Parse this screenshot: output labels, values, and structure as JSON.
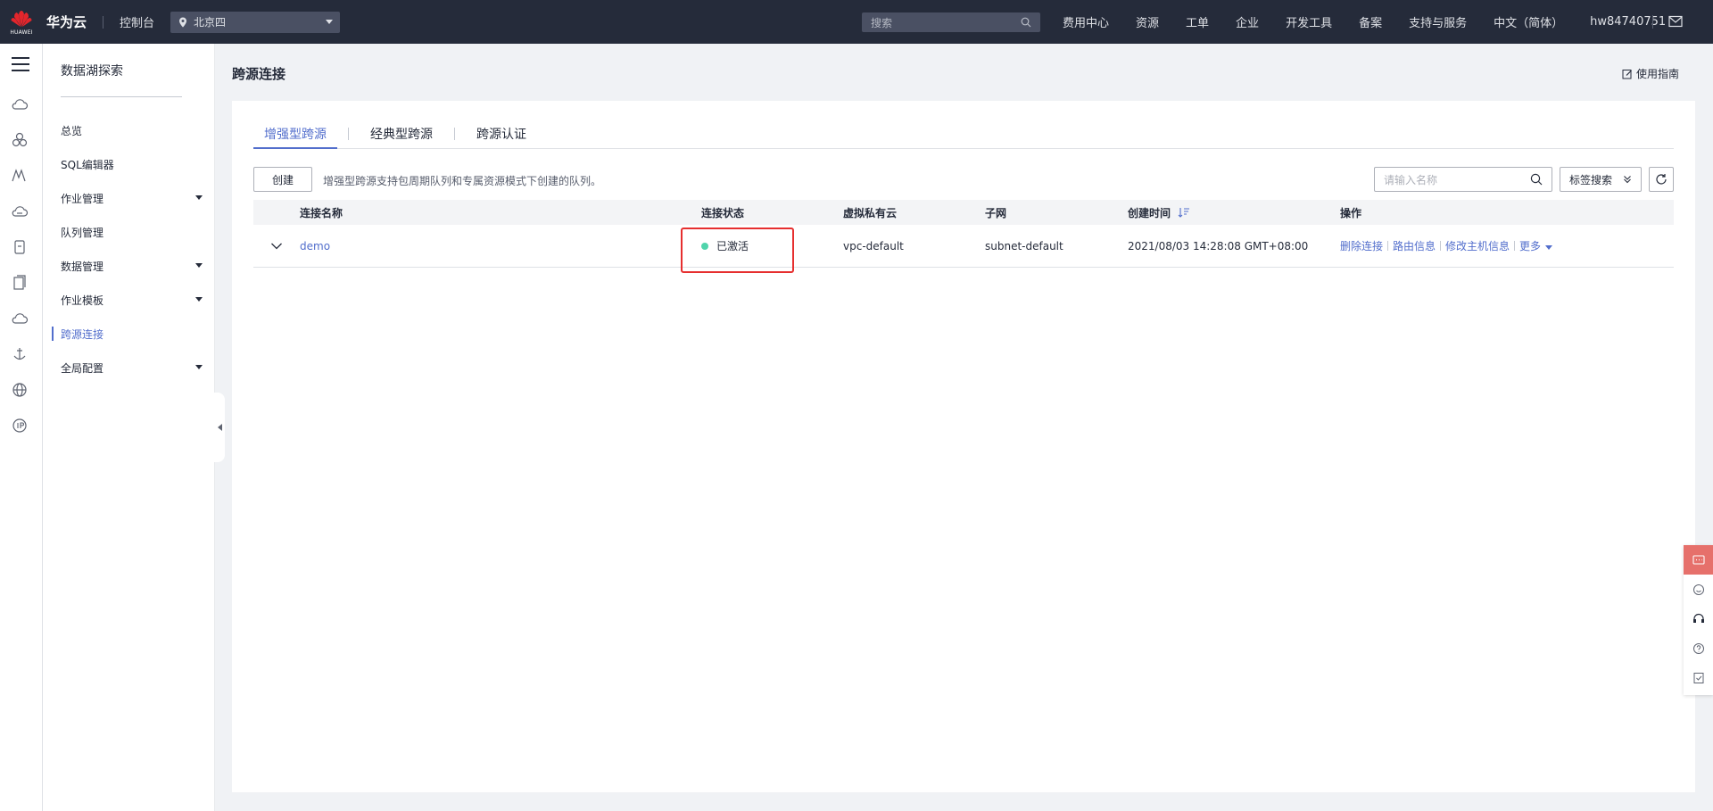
{
  "topbar": {
    "logo_text": "HUAWEI",
    "brand": "华为云",
    "console": "控制台",
    "region": "北京四",
    "search_placeholder": "搜索",
    "nav": [
      "费用中心",
      "资源",
      "工单",
      "企业",
      "开发工具",
      "备案",
      "支持与服务",
      "中文（简体）",
      "hw84740751"
    ]
  },
  "sidebar": {
    "title": "数据湖探索",
    "items": [
      {
        "label": "总览"
      },
      {
        "label": "SQL编辑器"
      },
      {
        "label": "作业管理"
      },
      {
        "label": "队列管理"
      },
      {
        "label": "数据管理"
      },
      {
        "label": "作业模板"
      },
      {
        "label": "跨源连接"
      },
      {
        "label": "全局配置"
      }
    ]
  },
  "page": {
    "title": "跨源连接",
    "guide": "使用指南"
  },
  "tabs": [
    "增强型跨源",
    "经典型跨源",
    "跨源认证"
  ],
  "toolbar": {
    "create": "创建",
    "hint": "增强型跨源支持包周期队列和专属资源模式下创建的队列。",
    "search_placeholder": "请输入名称",
    "tag_search": "标签搜索"
  },
  "table": {
    "headers": [
      "连接名称",
      "连接状态",
      "虚拟私有云",
      "子网",
      "创建时间",
      "操作"
    ],
    "rows": [
      {
        "name": "demo",
        "status": "已激活",
        "vpc": "vpc-default",
        "subnet": "subnet-default",
        "created": "2021/08/03 14:28:08 GMT+08:00",
        "ops": [
          "删除连接",
          "路由信息",
          "修改主机信息",
          "更多"
        ]
      }
    ]
  },
  "colors": {
    "accent": "#526ecc",
    "topbar": "#252b3a",
    "status_active": "#50d4ab",
    "highlight": "#e62f2f"
  }
}
